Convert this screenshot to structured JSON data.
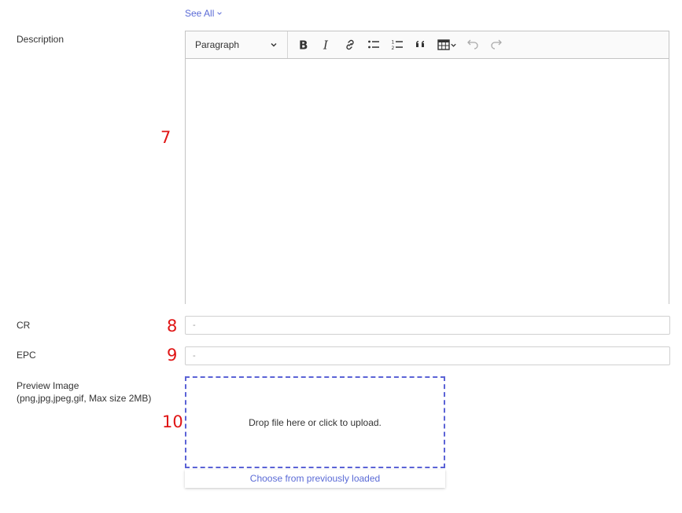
{
  "see_all": {
    "label": "See All"
  },
  "description": {
    "label": "Description",
    "marker": "7",
    "toolbar": {
      "paragraph_label": "Paragraph",
      "buttons": [
        "bold-icon",
        "italic-icon",
        "link-icon",
        "bulleted-list-icon",
        "numbered-list-icon",
        "quote-icon",
        "table-icon",
        "undo-icon",
        "redo-icon"
      ]
    }
  },
  "cr": {
    "label": "CR",
    "marker": "8",
    "value": "-"
  },
  "epc": {
    "label": "EPC",
    "marker": "9",
    "value": "-"
  },
  "preview_image": {
    "label_line1": "Preview Image",
    "label_line2": "(png,jpg,jpeg,gif, Max size 2MB)",
    "marker": "10",
    "drop_text": "Drop file here or click to upload.",
    "choose_label": "Choose from previously loaded"
  },
  "colors": {
    "accent": "#5b6bd6",
    "marker": "#e01515",
    "dropzone_border": "#5b63d6"
  }
}
